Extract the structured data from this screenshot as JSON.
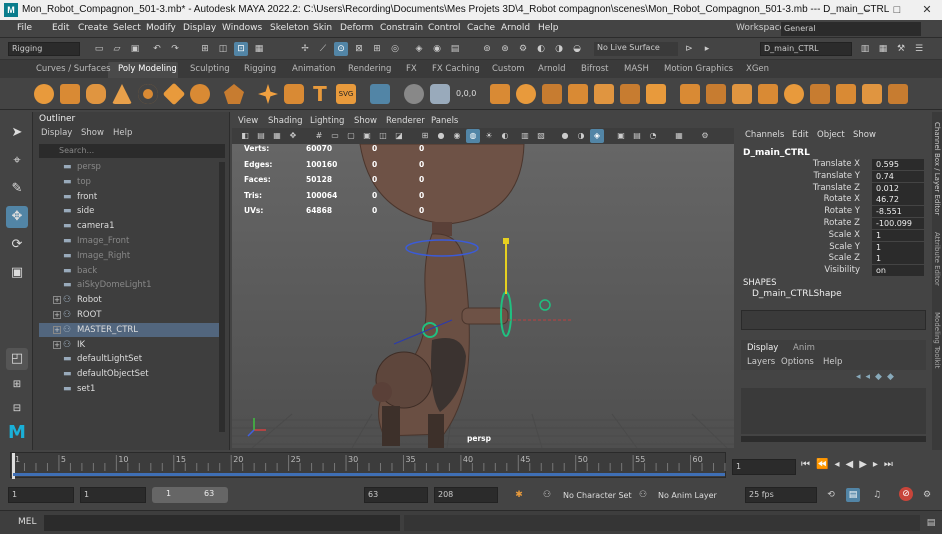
{
  "title_bar": {
    "text": "Mon_Robot_Compagnon_501-3.mb* - Autodesk MAYA 2022.2: C:\\Users\\Recording\\Documents\\Mes Projets 3D\\4_Robot compagnon\\scenes\\Mon_Robot_Compagnon_501-3.mb   ---   D_main_CTRL",
    "logo": "M"
  },
  "menu": [
    "File",
    "Edit",
    "Create",
    "Select",
    "Modify",
    "Display",
    "Windows",
    "Skeleton",
    "Skin",
    "Deform",
    "Constrain",
    "Control",
    "Cache",
    "Arnold",
    "Help"
  ],
  "workspace": {
    "label": "Workspace:",
    "value": "General"
  },
  "status_line": {
    "menu_set": "Rigging",
    "live_surface": "No Live Surface",
    "object_name": "D_main_CTRL"
  },
  "shelf_tabs": [
    "Curves / Surfaces",
    "Poly Modeling",
    "Sculpting",
    "Rigging",
    "Animation",
    "Rendering",
    "FX",
    "FX Caching",
    "Custom",
    "Arnold",
    "Bifrost",
    "MASH",
    "Motion Graphics",
    "XGen"
  ],
  "shelf_active": "Poly Modeling",
  "outliner": {
    "title": "Outliner",
    "menu": [
      "Display",
      "Show",
      "Help"
    ],
    "search_placeholder": "Search...",
    "items": [
      {
        "label": "persp",
        "dim": true,
        "expand": false
      },
      {
        "label": "top",
        "dim": true,
        "expand": false
      },
      {
        "label": "front",
        "dim": false,
        "expand": false
      },
      {
        "label": "side",
        "dim": false,
        "expand": false
      },
      {
        "label": "camera1",
        "dim": false,
        "expand": false
      },
      {
        "label": "Image_Front",
        "dim": true,
        "expand": false
      },
      {
        "label": "Image_Right",
        "dim": true,
        "expand": false
      },
      {
        "label": "back",
        "dim": true,
        "expand": false
      },
      {
        "label": "aiSkyDomeLight1",
        "dim": true,
        "expand": false
      },
      {
        "label": "Robot",
        "dim": false,
        "expand": true
      },
      {
        "label": "ROOT",
        "dim": false,
        "expand": true
      },
      {
        "label": "MASTER_CTRL",
        "dim": false,
        "expand": true,
        "selected": true
      },
      {
        "label": "IK",
        "dim": false,
        "expand": true
      },
      {
        "label": "defaultLightSet",
        "dim": false,
        "expand": false
      },
      {
        "label": "defaultObjectSet",
        "dim": false,
        "expand": false
      },
      {
        "label": "set1",
        "dim": false,
        "expand": false
      }
    ]
  },
  "viewport": {
    "menu": [
      "View",
      "Shading",
      "Lighting",
      "Show",
      "Renderer",
      "Panels"
    ],
    "camera_label": "persp",
    "stats": [
      {
        "label": "Verts:",
        "v1": "60070",
        "v2": "0",
        "v3": "0"
      },
      {
        "label": "Edges:",
        "v1": "100160",
        "v2": "0",
        "v3": "0"
      },
      {
        "label": "Faces:",
        "v1": "50128",
        "v2": "0",
        "v3": "0"
      },
      {
        "label": "Tris:",
        "v1": "100064",
        "v2": "0",
        "v3": "0"
      },
      {
        "label": "UVs:",
        "v1": "64868",
        "v2": "0",
        "v3": "0"
      }
    ]
  },
  "channel_box": {
    "menu": [
      "Channels",
      "Edit",
      "Object",
      "Show"
    ],
    "object": "D_main_CTRL",
    "channels": [
      {
        "label": "Translate X",
        "value": "0.595"
      },
      {
        "label": "Translate Y",
        "value": "0.74"
      },
      {
        "label": "Translate Z",
        "value": "0.012"
      },
      {
        "label": "Rotate X",
        "value": "46.72"
      },
      {
        "label": "Rotate Y",
        "value": "-8.551"
      },
      {
        "label": "Rotate Z",
        "value": "-100.099"
      },
      {
        "label": "Scale X",
        "value": "1"
      },
      {
        "label": "Scale Y",
        "value": "1"
      },
      {
        "label": "Scale Z",
        "value": "1"
      },
      {
        "label": "Visibility",
        "value": "on"
      }
    ],
    "shapes_header": "SHAPES",
    "shape_name": "D_main_CTRLShape",
    "layer_tabs": [
      "Display",
      "Anim"
    ],
    "layer_menu": [
      "Layers",
      "Options",
      "Help"
    ]
  },
  "side_tabs": [
    "Channel Box / Layer Editor",
    "Attribute Editor",
    "Modeling Toolkit"
  ],
  "time_slider": {
    "ticks": [
      "1",
      "5",
      "10",
      "15",
      "20",
      "25",
      "30",
      "35",
      "40",
      "45",
      "50",
      "55",
      "60"
    ],
    "current_frame": "1"
  },
  "range_slider": {
    "start": "1",
    "range_start": "1",
    "inner_start": "1",
    "inner_end": "63",
    "range_end": "63",
    "end": "208",
    "character_set": "No Character Set",
    "anim_layer": "No Anim Layer",
    "fps": "25 fps"
  },
  "command_line": {
    "label": "MEL"
  },
  "colors": {
    "selection": "#52667e",
    "accent": "#5285a6",
    "shelf_orange": "#e89a3c",
    "timeline_bar": "#3f6fb5"
  }
}
